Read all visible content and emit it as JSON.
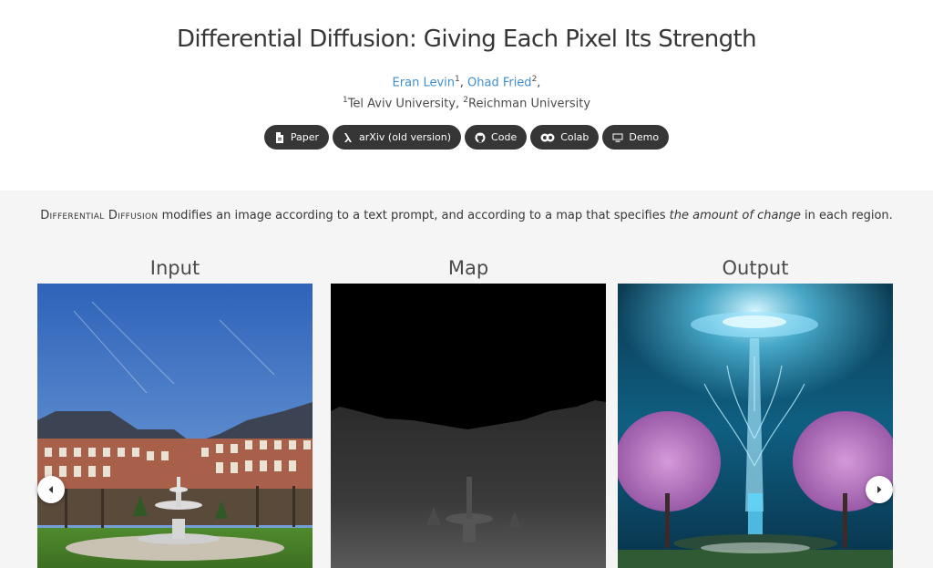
{
  "header": {
    "title": "Differential Diffusion: Giving Each Pixel Its Strength",
    "authors": [
      {
        "name": "Eran Levin",
        "sup": "1",
        "sep": ", "
      },
      {
        "name": "Ohad Fried",
        "sup": "2",
        "sep": ","
      }
    ],
    "affiliations": [
      {
        "sup": "1",
        "name": "Tel Aviv University",
        "sep": ", "
      },
      {
        "sup": "2",
        "name": "Reichman University",
        "sep": ""
      }
    ],
    "links": [
      {
        "label": "Paper",
        "icon": "pdf-icon"
      },
      {
        "label": "arXiv (old version)",
        "icon": "arxiv-icon"
      },
      {
        "label": "Code",
        "icon": "github-icon"
      },
      {
        "label": "Colab",
        "icon": "colab-icon"
      },
      {
        "label": "Demo",
        "icon": "monitor-icon"
      }
    ]
  },
  "description": {
    "method_name": "Differential Diffusion",
    "text_1": " modifies an image according to a text prompt, and according to a map that specifies ",
    "emphasis": "the amount of change",
    "text_2": " in each region."
  },
  "carousel": {
    "columns": [
      {
        "label": "Input",
        "image": "fountain-square-photo"
      },
      {
        "label": "Map",
        "image": "grayscale-change-map"
      },
      {
        "label": "Output",
        "image": "underwater-fantasy-garden"
      }
    ],
    "prev_icon": "chevron-left-icon",
    "next_icon": "chevron-right-icon"
  },
  "colors": {
    "pill_bg": "#363636",
    "link": "#3e8ed0",
    "band_bg": "#f5f5f5"
  }
}
